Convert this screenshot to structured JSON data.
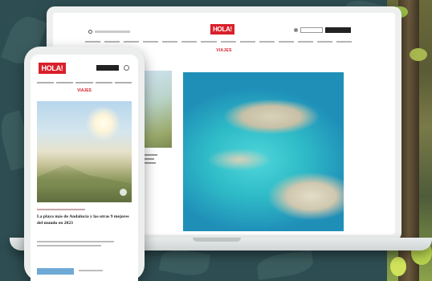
{
  "desktop": {
    "logo": "HOLA!",
    "section_label": "VIAJES",
    "search_icon": "search-icon",
    "nav_items_count": 14
  },
  "phone": {
    "logo": "HOLA!",
    "section_label": "VIAJES",
    "headline": "La playa más de Andalucía y las otras 9 mejores del mundo en 2023"
  },
  "colors": {
    "brand_red": "#d9202b",
    "background": "#2e4d52"
  }
}
